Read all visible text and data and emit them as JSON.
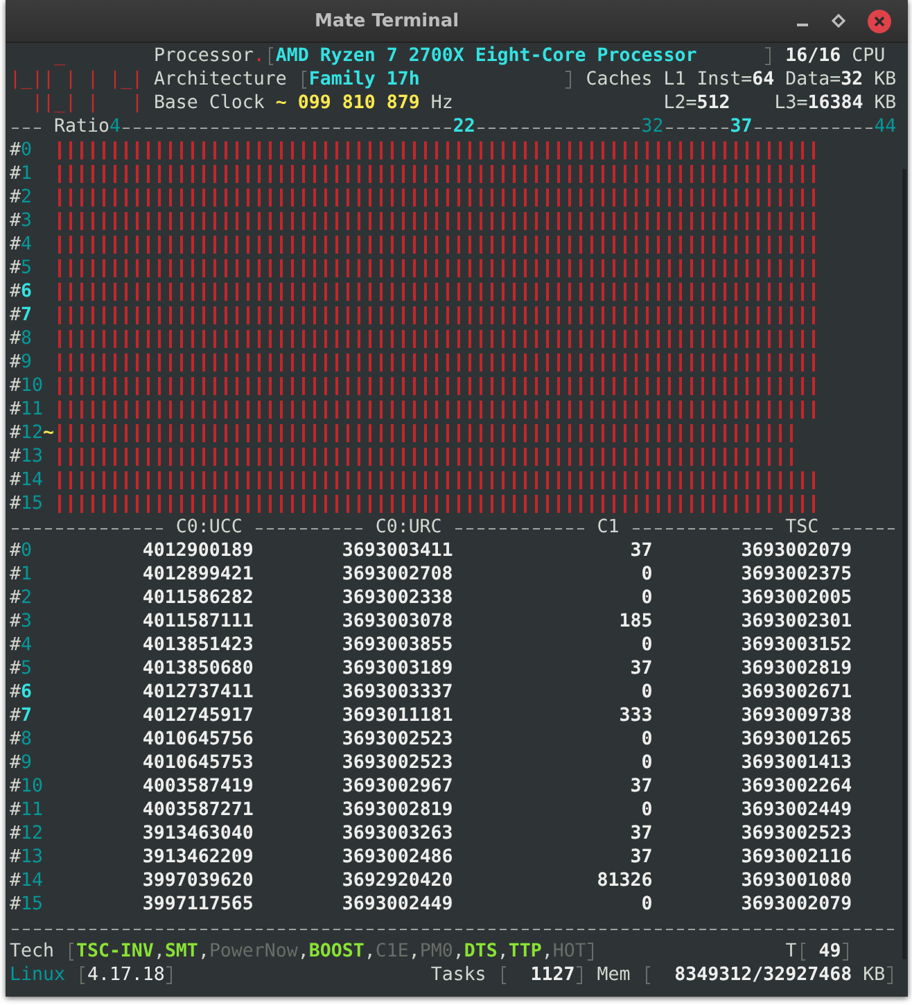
{
  "window": {
    "title": "Mate Terminal"
  },
  "logo": [
    "    _",
    "|_|| | | |_|",
    "  ||_| |   |"
  ],
  "processor": {
    "label": "Processor",
    "separator": ".",
    "name": "AMD Ryzen 7 2700X Eight-Core Processor",
    "cpu_count": "16/16",
    "unit": "CPU"
  },
  "architecture": {
    "label": "Architecture",
    "value": "Family 17h"
  },
  "caches": {
    "label": "Caches",
    "l1": "L1",
    "l1_inst": "Inst=**64**",
    "l1_data": "Data=**32**",
    "l1_unit": "KB",
    "l2": "L2=**512**",
    "l3": "L3=**16384**",
    "l3_unit": "KB"
  },
  "base_clock": {
    "label": "Base Clock",
    "value": "~ 099 810 879",
    "unit": "Hz"
  },
  "cpu_ratio": {
    "tick_bold": [
      false,
      true,
      false,
      true,
      false
    ],
    "cpus": [
      {
        "bold": false
      },
      {
        "bold": false
      },
      {
        "bold": false
      },
      {
        "bold": false
      },
      {
        "bold": false
      },
      {
        "bold": false
      },
      {
        "bold": true
      },
      {
        "bold": true
      },
      {
        "bold": false
      },
      {
        "bold": false
      },
      {
        "bold": false
      },
      {
        "bold": false
      },
      {
        "bold": false,
        "marker": "~"
      },
      {
        "bold": false
      },
      {
        "bold": false
      },
      {
        "bold": false
      }
    ],
    "chart_data": {
      "type": "bar",
      "orientation": "horizontal",
      "xlabel": "Ratio",
      "categories": [
        "#0",
        "#1",
        "#2",
        "#3",
        "#4",
        "#5",
        "#6",
        "#7",
        "#8",
        "#9",
        "#10",
        "#11",
        "#12",
        "#13",
        "#14",
        "#15"
      ],
      "values": [
        40.74,
        40.74,
        40.74,
        40.74,
        40.74,
        40.74,
        40.74,
        40.74,
        40.74,
        40.74,
        40.74,
        40.74,
        39.52,
        39.52,
        40.74,
        40.74
      ],
      "xlim": [
        0.83,
        44
      ],
      "xticks": [
        4,
        22,
        32,
        37,
        44
      ]
    }
  },
  "table": {
    "columns": [
      "C0:UCC",
      "C0:URC",
      "C1",
      "TSC"
    ],
    "rows": [
      {
        "cpu": "#0",
        "bold": false,
        "values": [
          "4012900189",
          "3693003411",
          "37",
          "3693002079"
        ]
      },
      {
        "cpu": "#1",
        "bold": false,
        "values": [
          "4012899421",
          "3693002708",
          "0",
          "3693002375"
        ]
      },
      {
        "cpu": "#2",
        "bold": false,
        "values": [
          "4011586282",
          "3693002338",
          "0",
          "3693002005"
        ]
      },
      {
        "cpu": "#3",
        "bold": false,
        "values": [
          "4011587111",
          "3693003078",
          "185",
          "3693002301"
        ]
      },
      {
        "cpu": "#4",
        "bold": false,
        "values": [
          "4013851423",
          "3693003855",
          "0",
          "3693003152"
        ]
      },
      {
        "cpu": "#5",
        "bold": false,
        "values": [
          "4013850680",
          "3693003189",
          "37",
          "3693002819"
        ]
      },
      {
        "cpu": "#6",
        "bold": true,
        "values": [
          "4012737411",
          "3693003337",
          "0",
          "3693002671"
        ]
      },
      {
        "cpu": "#7",
        "bold": true,
        "values": [
          "4012745917",
          "3693011181",
          "333",
          "3693009738"
        ]
      },
      {
        "cpu": "#8",
        "bold": false,
        "values": [
          "4010645756",
          "3693002523",
          "0",
          "3693001265"
        ]
      },
      {
        "cpu": "#9",
        "bold": false,
        "values": [
          "4010645753",
          "3693002523",
          "0",
          "3693001413"
        ]
      },
      {
        "cpu": "#10",
        "bold": false,
        "values": [
          "4003587419",
          "3693002967",
          "37",
          "3693002264"
        ]
      },
      {
        "cpu": "#11",
        "bold": false,
        "values": [
          "4003587271",
          "3693002819",
          "0",
          "3693002449"
        ]
      },
      {
        "cpu": "#12",
        "bold": false,
        "values": [
          "3913463040",
          "3693003263",
          "37",
          "3693002523"
        ]
      },
      {
        "cpu": "#13",
        "bold": false,
        "values": [
          "3913462209",
          "3693002486",
          "37",
          "3693002116"
        ]
      },
      {
        "cpu": "#14",
        "bold": false,
        "values": [
          "3997039620",
          "3692920420",
          "81326",
          "3693001080"
        ]
      },
      {
        "cpu": "#15",
        "bold": false,
        "values": [
          "3997117565",
          "3693002449",
          "0",
          "3693002079"
        ]
      }
    ]
  },
  "tech": {
    "label": "Tech",
    "separator": ",",
    "features": [
      {
        "name": "TSC-INV",
        "on": true
      },
      {
        "name": "SMT",
        "on": true
      },
      {
        "name": "PowerNow",
        "on": false
      },
      {
        "name": "BOOST",
        "on": true
      },
      {
        "name": "C1E",
        "on": false
      },
      {
        "name": "PM0",
        "on": false
      },
      {
        "name": "DTS",
        "on": true
      },
      {
        "name": "TTP",
        "on": true
      },
      {
        "name": "HOT",
        "on": false
      }
    ]
  },
  "temperature": {
    "label": "T",
    "value": "49"
  },
  "system": {
    "os": "Linux",
    "version": "4.17.18"
  },
  "tasks": {
    "label": "Tasks",
    "value": "1127"
  },
  "memory": {
    "label": "Mem",
    "value": "8349312/32927468",
    "unit": "KB"
  }
}
